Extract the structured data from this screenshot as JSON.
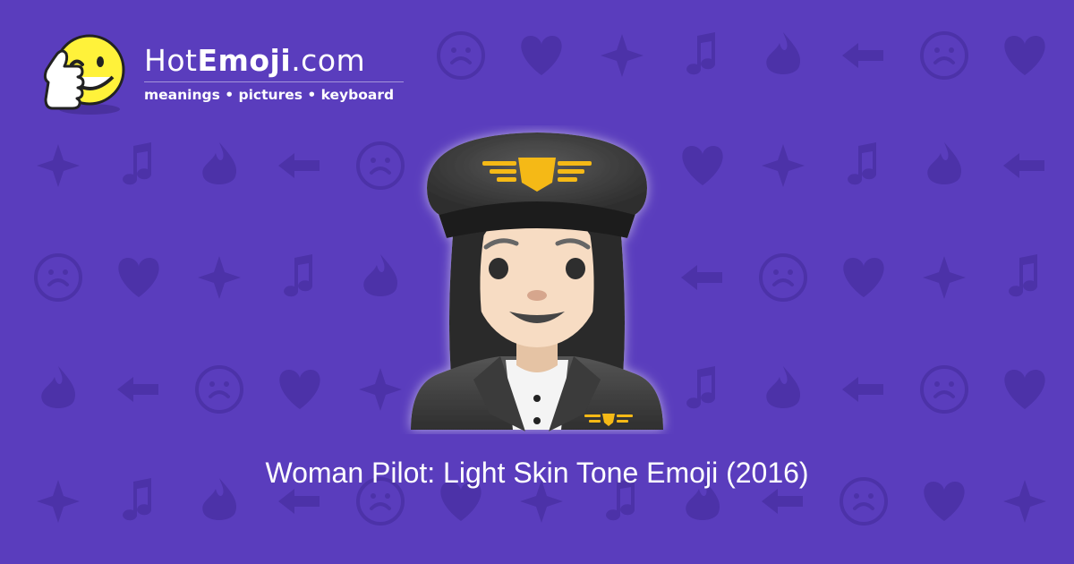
{
  "logo": {
    "brand_prefix": "Hot",
    "brand_bold": "Emoji",
    "brand_suffix": ".com",
    "tagline": "meanings • pictures • keyboard",
    "icon": "winking-thumbs-up-smiley-icon"
  },
  "hero": {
    "emoji": "woman-pilot-light-skin-tone",
    "caption": "Woman Pilot: Light Skin Tone Emoji (2016)"
  },
  "background": {
    "base_color": "#5a3dbd",
    "pattern_color": "#4c32a8",
    "pattern_icons": [
      "smiley-face-icon",
      "heart-icon",
      "star-icon",
      "music-note-icon",
      "fire-icon",
      "arrow-icon"
    ]
  }
}
